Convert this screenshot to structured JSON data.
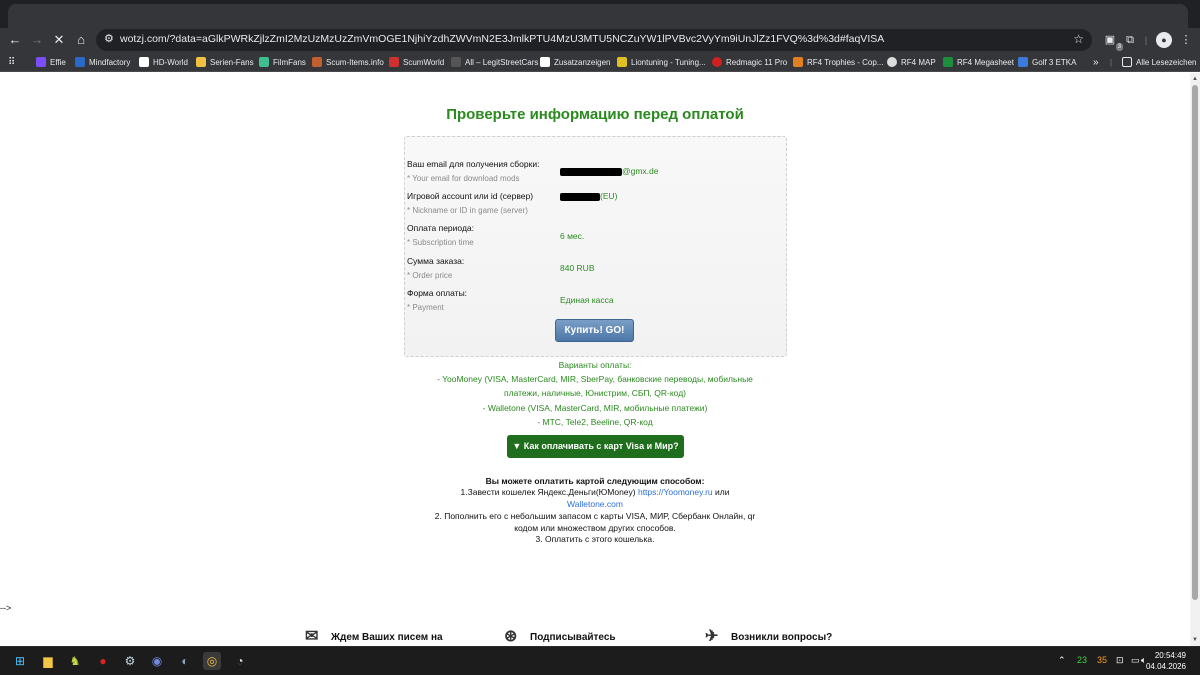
{
  "browser": {
    "url": "wotzj.com/?data=aGlkPWRkZjlzZmI2MzUzMzUzZmVmOGE1NjhiYzdhZWVmN2E3JmlkPTU4MzU3MTU5NCZuYW1lPVBvc2VyYm9iUnJlZz1FVQ%3d%3d#faqVISA",
    "ext_badge": "3",
    "bookmarks": [
      "Effie",
      "Mindfactory",
      "HD-World",
      "Serien-Fans",
      "FilmFans",
      "Scum-Items.info",
      "ScumWorld",
      "All – LegitStreetCars",
      "Zusatzanzeigen",
      "Liontuning - Tuning...",
      "Redmagic 11 Pro",
      "RF4 Trophies - Cop...",
      "RF4 MAP",
      "RF4 Megasheet",
      "Golf 3 ETKA"
    ],
    "bookmarks_overflow": "»",
    "all_bookmarks": "Alle Lesezeichen"
  },
  "page": {
    "headline": "Проверьте информацию перед оплатой",
    "rows": [
      {
        "label": "Ваш email для получения сборки:",
        "sub": "* Your email for download mods",
        "value": "@gmx.de"
      },
      {
        "label": "Игровой account или id (сервер)",
        "sub": "* Nickname or ID in game (server)",
        "value": "(EU)"
      },
      {
        "label": "Оплата периода:",
        "sub": "* Subscription time",
        "value": "6 мес."
      },
      {
        "label": "Сумма заказа:",
        "sub": "* Order price",
        "value": "840 RUB"
      },
      {
        "label": "Форма оплаты:",
        "sub": "* Payment",
        "value": "Единая касса"
      }
    ],
    "buy_button": "Купить! GO!",
    "pay_title": "Варианты оплаты:",
    "pay_lines": [
      "- YooMoney (VISA, MasterCard, MIR, SberPay, банковские переводы, мобильные",
      "платежи, наличные, Юнистрим, СБП, QR-код)",
      "- Walletone (VISA, MasterCard, MIR, мобильные платежи)",
      "- МТС, Tele2, Beeline, QR-код"
    ],
    "how_button": "▼ Как оплачивать с карт Visa и Мир?",
    "instructions": {
      "line1": "Вы можете оплатить картой следующим способом:",
      "line2_pre": "1.Завести кошелек Яндекс.Деньги(ЮMoney) ",
      "line2_link": "https://Yoomoney.ru",
      "line2_post": " или",
      "line3_link": "Walletone.com",
      "line4": "2. Пополнить его с небольшим запасом с карты VISA, МИР, Сбербанк Онлайн, qr",
      "line5": "кодом или множеством других способов.",
      "line6": "3. Оплатить с этого кошелька."
    },
    "stray_text": "-->",
    "footer": [
      {
        "label": "Ждем Ваших писем на"
      },
      {
        "label": "Подписывайтесь"
      },
      {
        "label": "Возникли вопросы?"
      }
    ]
  },
  "taskbar": {
    "tray_green": "23",
    "tray_orange": "35",
    "time": "20:54:49",
    "date": "04.04.2026"
  }
}
